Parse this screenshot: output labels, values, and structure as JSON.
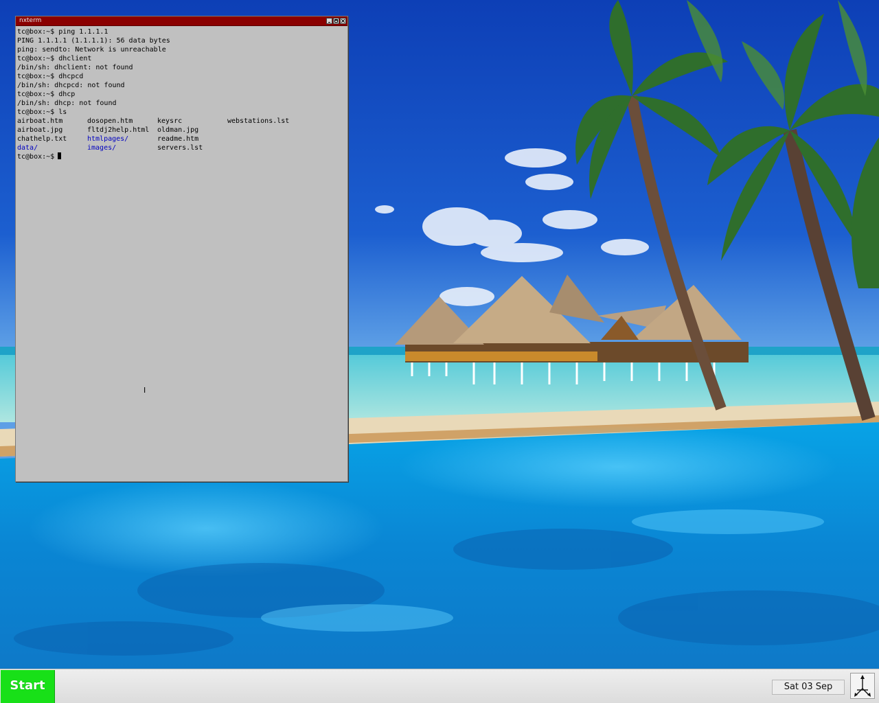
{
  "terminal": {
    "title": "nxterm",
    "lines": [
      "tc@box:~$ ping 1.1.1.1",
      "PING 1.1.1.1 (1.1.1.1): 56 data bytes",
      "ping: sendto: Network is unreachable",
      "tc@box:~$ dhclient",
      "/bin/sh: dhclient: not found",
      "tc@box:~$ dhcpcd",
      "/bin/sh: dhcpcd: not found",
      "tc@box:~$ dhcp",
      "/bin/sh: dhcp: not found",
      "tc@box:~$ ls"
    ],
    "ls_rows": [
      [
        "airboat.htm",
        "dosopen.htm",
        "keysrc",
        "webstations.lst"
      ],
      [
        "airboat.jpg",
        "fltdj2help.html",
        "oldman.jpg",
        ""
      ],
      [
        "chathelp.txt",
        "htmlpages/",
        "readme.htm",
        ""
      ],
      [
        "data/",
        "images/",
        "servers.lst",
        ""
      ]
    ],
    "prompt": "tc@box:~$",
    "mouse_cursor": "Ⅰ"
  },
  "taskbar": {
    "start_label": "Start",
    "clock": "Sat 03 Sep",
    "app_icon": "pointer-arrows-icon"
  },
  "colors": {
    "titlebar": "#8a0000",
    "terminal_bg": "#c0c0c0",
    "directory_text": "#0000c0",
    "start_button": "#18e018"
  }
}
